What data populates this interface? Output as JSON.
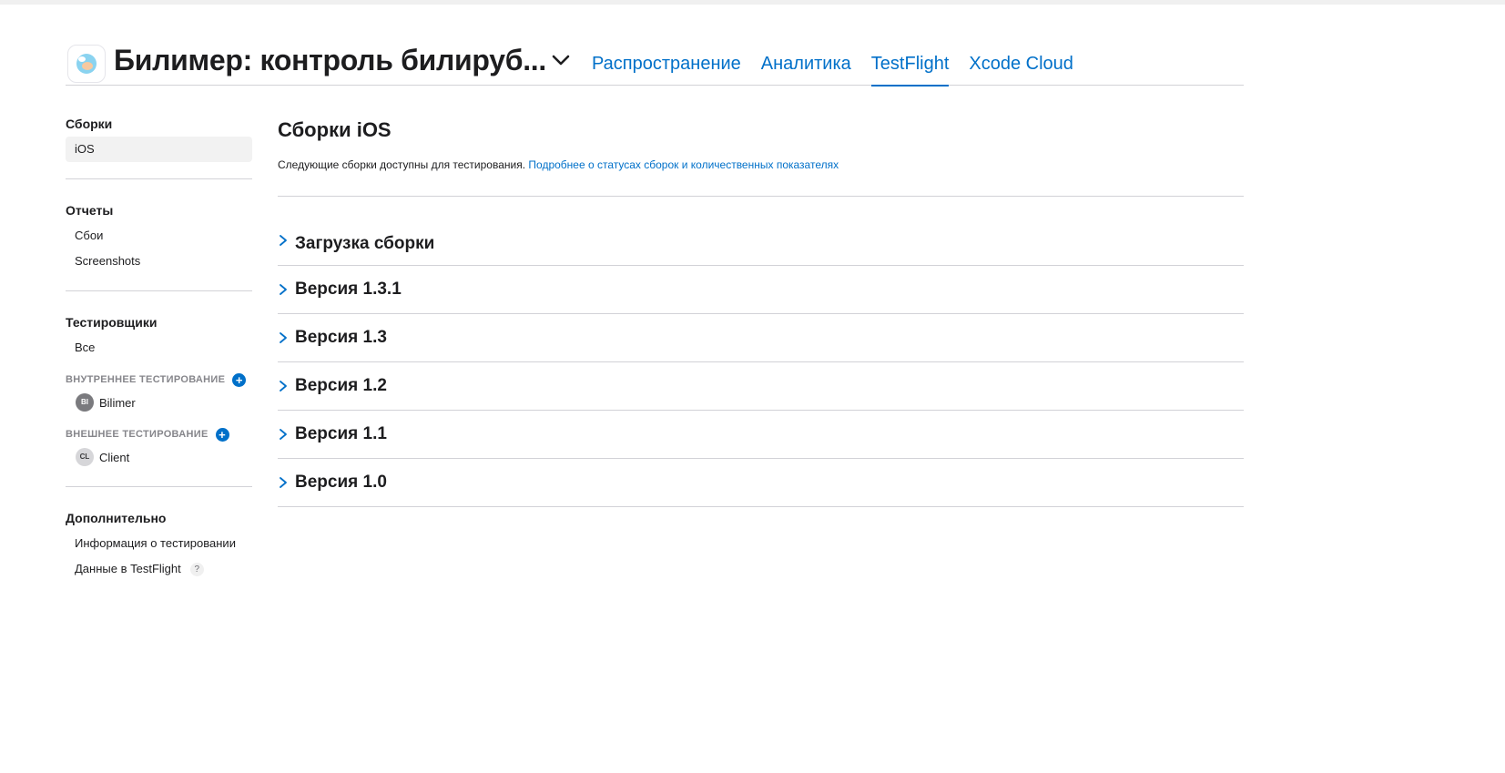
{
  "header": {
    "app_title": "Билимер: контроль билируб...",
    "tabs": [
      {
        "label": "Распространение",
        "active": false
      },
      {
        "label": "Аналитика",
        "active": false
      },
      {
        "label": "TestFlight",
        "active": true
      },
      {
        "label": "Xcode Cloud",
        "active": false
      }
    ]
  },
  "sidebar": {
    "builds": {
      "heading": "Сборки",
      "items": [
        "iOS"
      ]
    },
    "reports": {
      "heading": "Отчеты",
      "items": [
        "Сбои",
        "Screenshots"
      ]
    },
    "testers": {
      "heading": "Тестировщики",
      "all_label": "Все",
      "internal": {
        "label": "ВНУТРЕННЕЕ ТЕСТИРОВАНИЕ",
        "groups": [
          {
            "initials": "BI",
            "name": "Bilimer"
          }
        ]
      },
      "external": {
        "label": "ВНЕШНЕЕ ТЕСТИРОВАНИЕ",
        "groups": [
          {
            "initials": "CL",
            "name": "Client"
          }
        ]
      }
    },
    "additional": {
      "heading": "Дополнительно",
      "items": [
        "Информация о тестировании",
        "Данные в TestFlight"
      ],
      "help_glyph": "?"
    }
  },
  "main": {
    "title": "Сборки iOS",
    "description": "Следующие сборки доступны для тестирования.",
    "description_link": "Подробнее о статусах сборок и количественных показателях",
    "sections": [
      "Загрузка сборки",
      "Версия 1.3.1",
      "Версия 1.3",
      "Версия 1.2",
      "Версия 1.1",
      "Версия 1.0"
    ]
  },
  "colors": {
    "accent": "#0070c9",
    "divider": "#d2d2d7",
    "selected_bg": "#f2f2f2"
  },
  "icons": [
    "app-icon",
    "chevron-down-icon",
    "chevron-right-icon",
    "plus-icon",
    "help-icon"
  ]
}
